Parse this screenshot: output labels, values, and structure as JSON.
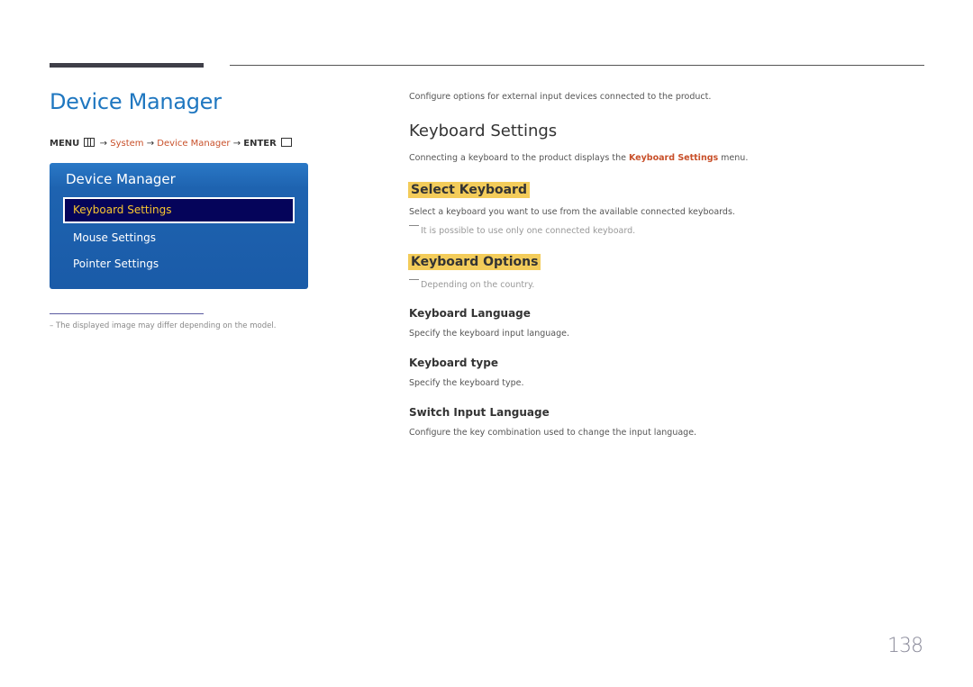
{
  "page": {
    "title": "Device Manager",
    "page_number": "138"
  },
  "menu_path": {
    "menu": "MENU",
    "arrow": "→",
    "system": "System",
    "device_manager": "Device Manager",
    "enter": "ENTER"
  },
  "osd": {
    "title": "Device Manager",
    "items": [
      {
        "label": "Keyboard Settings",
        "selected": true
      },
      {
        "label": "Mouse Settings",
        "selected": false
      },
      {
        "label": "Pointer Settings",
        "selected": false
      }
    ]
  },
  "footnote": "The displayed image may differ depending on the model.",
  "content": {
    "intro": "Configure options for external input devices connected to the product.",
    "keyboard_settings": {
      "heading": "Keyboard Settings",
      "desc_prefix": "Connecting a keyboard to the product displays the ",
      "desc_highlight": "Keyboard Settings",
      "desc_suffix": " menu."
    },
    "select_keyboard": {
      "heading": "Select Keyboard",
      "desc": "Select a keyboard you want to use from the available connected keyboards.",
      "note": "It is possible to use only one connected keyboard."
    },
    "keyboard_options": {
      "heading": "Keyboard Options",
      "note": "Depending on the country.",
      "items": [
        {
          "heading": "Keyboard Language",
          "desc": "Specify the keyboard input language."
        },
        {
          "heading": "Keyboard type",
          "desc": "Specify the keyboard type."
        },
        {
          "heading": "Switch Input Language",
          "desc": "Configure the key combination used to change the input language."
        }
      ]
    }
  }
}
